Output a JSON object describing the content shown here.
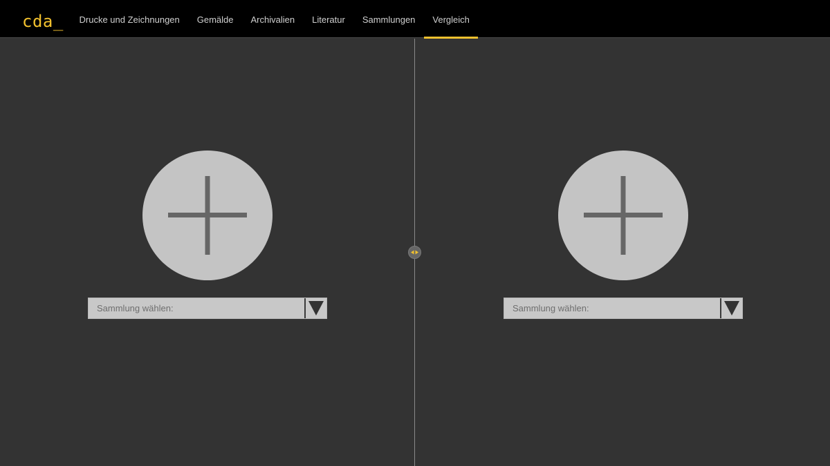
{
  "app": {
    "logo": "cda_"
  },
  "nav": {
    "items": [
      {
        "label": "Drucke und Zeichnungen",
        "active": false
      },
      {
        "label": "Gemälde",
        "active": false
      },
      {
        "label": "Archivalien",
        "active": false
      },
      {
        "label": "Literatur",
        "active": false
      },
      {
        "label": "Sammlungen",
        "active": false
      },
      {
        "label": "Vergleich",
        "active": true
      }
    ]
  },
  "compare": {
    "left": {
      "add_icon": "plus-icon",
      "select_label": "Sammlung wählen:",
      "select_arrow_icon": "triangle-down-icon"
    },
    "right": {
      "add_icon": "plus-icon",
      "select_label": "Sammlung wählen:",
      "select_arrow_icon": "triangle-down-icon"
    },
    "divider_icon": "resize-arrows-icon"
  },
  "colors": {
    "accent": "#f2c12e",
    "topbar_bg": "#000000",
    "pane_bg": "#333333",
    "circle_bg": "#c4c4c4",
    "plus_stroke": "#666666",
    "select_bg": "#c8c8c8"
  }
}
